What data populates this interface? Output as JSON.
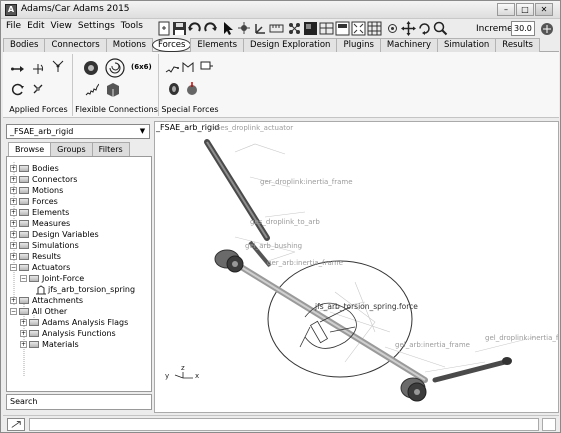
{
  "window": {
    "title": "Adams/Car Adams 2015",
    "app_icon": "A",
    "minimize_glyph": "–",
    "maximize_glyph": "□",
    "close_glyph": "✕"
  },
  "menubar": [
    "File",
    "Edit",
    "View",
    "Settings",
    "Tools"
  ],
  "toolbar": {
    "increment_label": "Increment",
    "increment_value": "30.0"
  },
  "tabs": [
    "Bodies",
    "Connectors",
    "Motions",
    "Forces",
    "Elements",
    "Design Exploration",
    "Plugins",
    "Machinery",
    "Simulation",
    "Results"
  ],
  "active_tab": "Forces",
  "ribbon": {
    "groups": [
      {
        "label": "Applied Forces"
      },
      {
        "label": "Flexible Connections",
        "badge": "(6x6)"
      },
      {
        "label": "Special Forces"
      }
    ]
  },
  "left_panel": {
    "model_selector": "_FSAE_arb_rigid",
    "subtabs": [
      "Browse",
      "Groups",
      "Filters"
    ],
    "active_subtab": "Browse",
    "tree": [
      {
        "label": "Bodies",
        "toggle": "+"
      },
      {
        "label": "Connectors",
        "toggle": "+"
      },
      {
        "label": "Motions",
        "toggle": "+"
      },
      {
        "label": "Forces",
        "toggle": "+"
      },
      {
        "label": "Elements",
        "toggle": "+"
      },
      {
        "label": "Measures",
        "toggle": "+"
      },
      {
        "label": "Design Variables",
        "toggle": "+"
      },
      {
        "label": "Simulations",
        "toggle": "+"
      },
      {
        "label": "Results",
        "toggle": "+"
      },
      {
        "label": "Actuators",
        "toggle": "−"
      },
      {
        "label": "Joint-Force",
        "toggle": "−"
      },
      {
        "label": "jfs_arb_torsion_spring",
        "toggle": ""
      },
      {
        "label": "Attachments",
        "toggle": "+"
      },
      {
        "label": "All Other",
        "toggle": "−"
      },
      {
        "label": "Adams Analysis Flags",
        "toggle": "+"
      },
      {
        "label": "Analysis Functions",
        "toggle": "+"
      },
      {
        "label": "Materials",
        "toggle": "+"
      }
    ],
    "search_label": "Search"
  },
  "viewport": {
    "model_name": "_FSAE_arb_rigid",
    "labels": {
      "top_marker": "Ges_droplink_actuator",
      "droplink_inertia": "ger_droplink:inertia_frame",
      "droplink_to_arb": "ges_droplink_to_arb",
      "arb_bushing": "gel_arb_bushing",
      "arb_inertia": "ger_arb:inertia_frame",
      "torsion_spring": "jfs_arb_torsion_spring.force",
      "droplink_inertia_left": "gel_droplink:inertia_fr",
      "arb_inertia_left": "gel_arb:inertia_frame",
      "triad_y": "y",
      "triad_z": "z",
      "triad_x": "x"
    }
  },
  "colors": {
    "window_bg": "#ececec",
    "viewport_bg": "#ffffff",
    "model_gray": "#7b7b7b",
    "link_dark": "#5a5a5a"
  }
}
